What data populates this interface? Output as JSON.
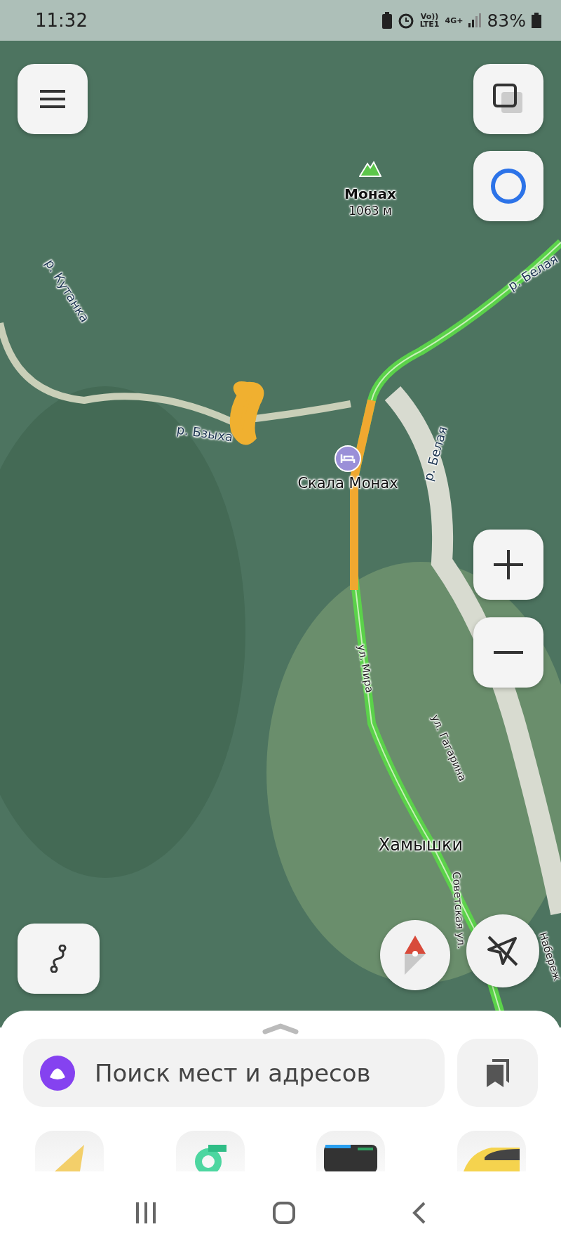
{
  "status_bar": {
    "time": "11:32",
    "network_labels": [
      "Vo))",
      "LTE1",
      "4G+"
    ],
    "battery": "83%"
  },
  "map": {
    "labels": [
      {
        "kind": "peak",
        "text": "Монах"
      },
      {
        "kind": "elevation",
        "text": "1063 м"
      },
      {
        "kind": "river",
        "text": "р. Кутанка"
      },
      {
        "kind": "river",
        "text": "р. Бзыха"
      },
      {
        "kind": "river",
        "text": "р. Белая"
      },
      {
        "kind": "river",
        "text": "р. Белая"
      },
      {
        "kind": "poi",
        "text": "Скала Монах"
      },
      {
        "kind": "street",
        "text": "ул. Мира"
      },
      {
        "kind": "street",
        "text": "ул. Гагарина"
      },
      {
        "kind": "place",
        "text": "Хамышки"
      },
      {
        "kind": "street",
        "text": "Советская ул."
      },
      {
        "kind": "street",
        "text": "Набереж"
      }
    ]
  },
  "search": {
    "placeholder": "Поиск мест и адресов"
  },
  "apps": [
    {
      "kind": "navigator"
    },
    {
      "kind": "scooter"
    },
    {
      "kind": "transit"
    },
    {
      "kind": "taxi"
    }
  ]
}
